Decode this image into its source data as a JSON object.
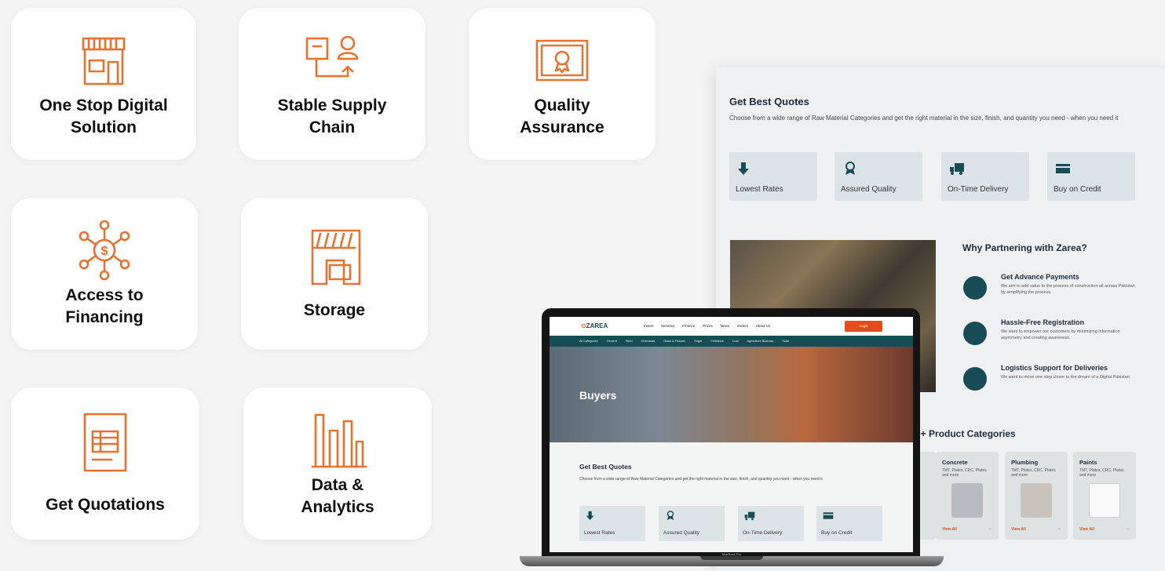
{
  "features": [
    {
      "label": "One Stop Digital\nSolution",
      "icon": "storefront-icon"
    },
    {
      "label": "Stable Supply\nChain",
      "icon": "supply-chain-icon"
    },
    {
      "label": "Quality\nAssurance",
      "icon": "certificate-icon"
    },
    {
      "label": "Access to\nFinancing",
      "icon": "dollar-network-icon"
    },
    {
      "label": "Storage",
      "icon": "warehouse-icon"
    },
    {
      "label": "Get Quotations",
      "icon": "document-icon"
    },
    {
      "label": "Data &\nAnalytics",
      "icon": "bar-chart-icon"
    }
  ],
  "accent_color": "#e8712f",
  "back_page": {
    "title": "Get Best Quotes",
    "description": "Choose from a wide range of Raw Material Categories and get the right material in the size, finish, and quantity you need - when you need it",
    "features": [
      "Lowest Rates",
      "Assured Quality",
      "On-Time Delivery",
      "Buy on Credit"
    ],
    "why_title": "Why Partnering with Zarea?",
    "partner_items": [
      {
        "title": "Get Advance Payments",
        "desc": "We aim to add value to the process of construction all across Pakistan by simplifying the process."
      },
      {
        "title": "Hassle-Free Registration",
        "desc": "We want to empower our customers by minimizing information asymmetry and creating awareness."
      },
      {
        "title": "Logistics Support for Deliveries",
        "desc": "We want to move one step closer to the dream of a Digital Pakistan."
      }
    ],
    "products_title": "0+ Product Categories",
    "products": [
      {
        "name": "Concrete",
        "desc": "TMT, Plates, CRC, Plates and more"
      },
      {
        "name": "Plumbing",
        "desc": "TMT, Plates, CRC, Plates and more"
      },
      {
        "name": "Paints",
        "desc": "TMT, Plates, CRC, Plates and more"
      }
    ],
    "view_all": "View All"
  },
  "laptop": {
    "logo": "ZAREA",
    "nav_links": [
      "Invest",
      "Services",
      "Finance",
      "Prices",
      "News",
      "Orders",
      "About Us"
    ],
    "login": "Login",
    "categories": [
      "All Categories",
      "Cement",
      "Steel",
      "Chemicals",
      "Glass & Fixtures",
      "Sugar",
      "Fertilizers",
      "Coal",
      "Agriculture Biomass",
      "Solar"
    ],
    "hero_title": "Buyers",
    "section_title": "Get Best Quotes",
    "section_desc": "Choose from a wide range of Raw Material Categories and get the right material in the size, finish, and quantity you need - when you need it",
    "features": [
      "Lowest Rates",
      "Assured Quality",
      "On-Time Delivery",
      "Buy on Credit"
    ],
    "model": "MacBook Pro"
  }
}
